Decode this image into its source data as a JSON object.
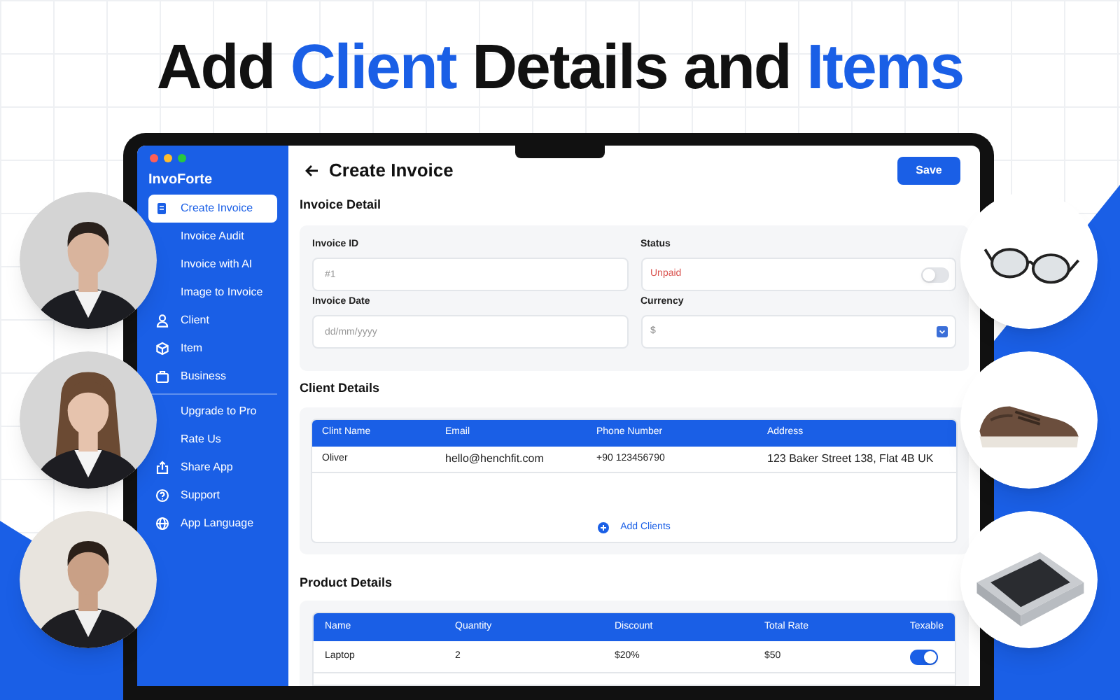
{
  "headline": [
    {
      "text": "Add",
      "highlight": false
    },
    {
      "text": "Client",
      "highlight": true
    },
    {
      "text": "Details and",
      "highlight": false
    },
    {
      "text": "Items",
      "highlight": true
    }
  ],
  "app": {
    "name": "InvoForte"
  },
  "sidebar": {
    "items": [
      {
        "label": "Create Invoice",
        "selected": true
      },
      {
        "label": "Invoice Audit",
        "selected": false
      },
      {
        "label": "Invoice with AI",
        "selected": false
      },
      {
        "label": "Image to Invoice",
        "selected": false
      },
      {
        "label": "Client",
        "selected": false
      },
      {
        "label": "Item",
        "selected": false
      },
      {
        "label": "Business",
        "selected": false
      }
    ],
    "footer_items": [
      {
        "label": "Upgrade to Pro"
      },
      {
        "label": "Rate Us"
      },
      {
        "label": "Share App"
      },
      {
        "label": "Support"
      },
      {
        "label": "App Language"
      }
    ]
  },
  "header": {
    "title": "Create Invoice",
    "save": "Save"
  },
  "invoice_detail": {
    "title": "Invoice Detail",
    "fields": [
      {
        "kind": "text",
        "label": "Invoice ID",
        "placeholder": "#1"
      },
      {
        "kind": "toggle",
        "label": "Status",
        "value": "Unpaid",
        "on": false
      },
      {
        "kind": "text",
        "label": "Invoice Date",
        "placeholder": "dd/mm/yyyy"
      },
      {
        "kind": "select",
        "label": "Currency",
        "value": "$"
      }
    ]
  },
  "client_details": {
    "title": "Client Details",
    "columns": [
      "Clint Name",
      "Email",
      "Phone Number",
      "Address"
    ],
    "rows": [
      [
        "Oliver",
        "hello@henchfit.com",
        "+90 123456790",
        "123 Baker Street 138, Flat 4B UK"
      ]
    ],
    "add_button": "Add Clients"
  },
  "product_details": {
    "title": "Product Details",
    "columns": [
      "Name",
      "Quantity",
      "Discount",
      "Total Rate",
      "Texable"
    ],
    "rows": [
      {
        "cells": [
          "Laptop",
          "2",
          "$20%",
          "$50"
        ],
        "taxable": true
      }
    ]
  }
}
